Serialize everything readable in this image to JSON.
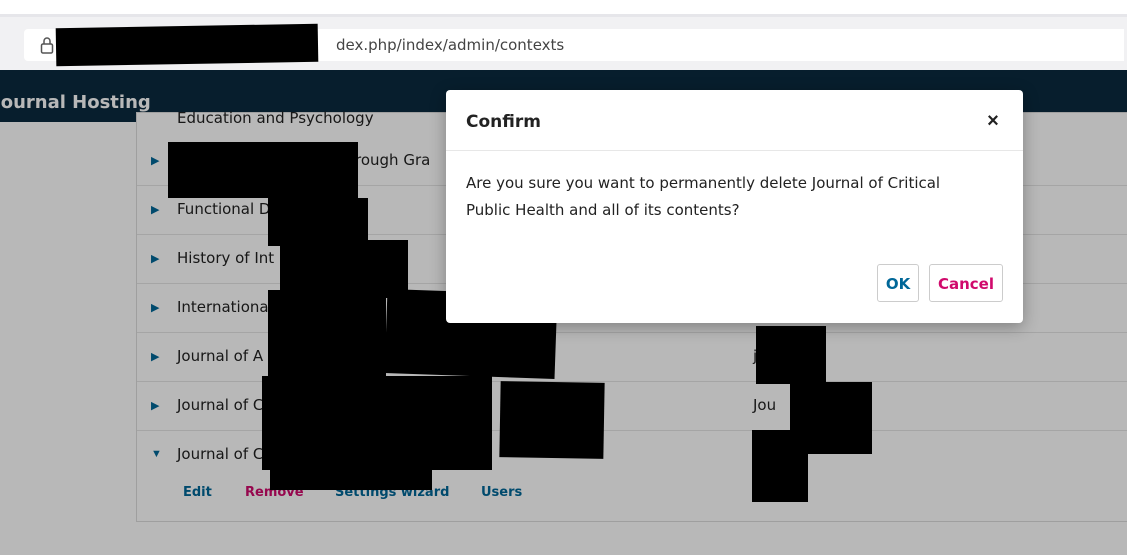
{
  "browser": {
    "url_fragment": "dex.php/index/admin/contexts"
  },
  "app": {
    "title": "Journal Hosting"
  },
  "list": {
    "top_partial": "Education and Psychology",
    "rows": [
      {
        "name": "",
        "name_tail": "rough Gra",
        "path": ""
      },
      {
        "name": "Functional D",
        "path": ""
      },
      {
        "name": "History of Int",
        "path": ""
      },
      {
        "name": "International",
        "path": ""
      },
      {
        "name": "Journal of A",
        "path": "j"
      },
      {
        "name": "Journal of C",
        "path": "Jou"
      },
      {
        "name": "Journal of Cr",
        "path": ""
      }
    ],
    "actions": {
      "edit": "Edit",
      "remove": "Remove",
      "settings_wizard": "Settings wizard",
      "users": "Users"
    }
  },
  "dialog": {
    "title": "Confirm",
    "close_glyph": "×",
    "message": "Are you sure you want to permanently delete Journal of Critical Public Health and all of its contents?",
    "ok_label": "OK",
    "cancel_label": "Cancel"
  },
  "colors": {
    "header_bg": "#0b2a3f",
    "link_blue": "#006798",
    "remove_pink": "#d00a6c"
  }
}
